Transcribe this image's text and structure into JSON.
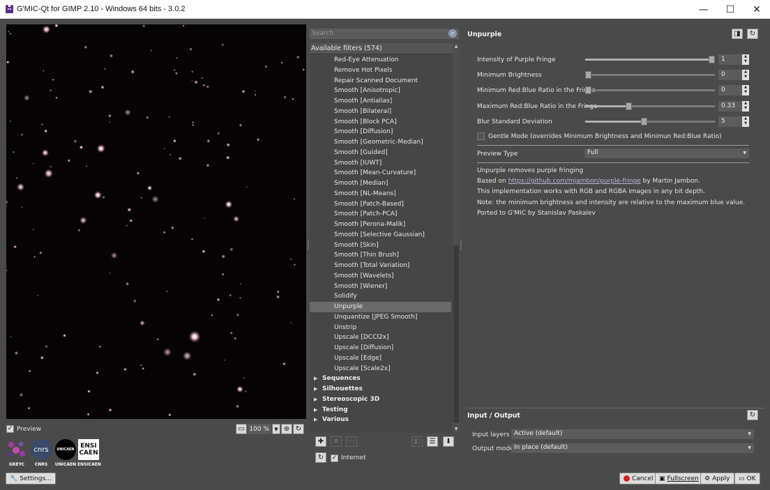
{
  "window": {
    "title": "G'MIC-Qt for GIMP 2.10 - Windows 64 bits - 3.0.2",
    "controls": {
      "minimize": "—",
      "maximize": "☐",
      "close": "✕"
    }
  },
  "preview": {
    "checkbox_label": "Preview",
    "checked": true,
    "zoom": "100 %"
  },
  "logos": [
    {
      "label": "GREYC"
    },
    {
      "label": "CNRS",
      "text": "cnrs"
    },
    {
      "label": "UNICAEN",
      "text": "UNICAEN"
    },
    {
      "label": "ENSICAEN",
      "text_top": "ENSI",
      "text_bottom": "CAEN"
    }
  ],
  "settings_button": "Settings...",
  "search": {
    "placeholder": "Search"
  },
  "filters": {
    "header": "Available filters (574)",
    "items": [
      "Red-Eye Attenuation",
      "Remove Hot Pixels",
      "Repair Scanned Document",
      "Smooth [Anisotropic]",
      "Smooth [Antialias]",
      "Smooth [Bilateral]",
      "Smooth [Block PCA]",
      "Smooth [Diffusion]",
      "Smooth [Geometric-Median]",
      "Smooth [Guided]",
      "Smooth [IUWT]",
      "Smooth [Mean-Curvature]",
      "Smooth [Median]",
      "Smooth [NL-Means]",
      "Smooth [Patch-Based]",
      "Smooth [Patch-PCA]",
      "Smooth [Perona-Malik]",
      "Smooth [Selective Gaussian]",
      "Smooth [Skin]",
      "Smooth [Thin Brush]",
      "Smooth [Total Variation]",
      "Smooth [Wavelets]",
      "Smooth [Wiener]",
      "Solidify",
      "Unpurple",
      "Unquantize [JPEG Smooth]",
      "Unstrip",
      "Upscale [DCCI2x]",
      "Upscale [Diffusion]",
      "Upscale [Edge]",
      "Upscale [Scale2x]"
    ],
    "selected_index": 24,
    "categories": [
      "Sequences",
      "Silhouettes",
      "Stereoscopic 3D",
      "Testing",
      "Various"
    ]
  },
  "internet": {
    "label": "Internet",
    "checked": true
  },
  "params": {
    "title": "Unpurple",
    "rows": [
      {
        "label": "Intensity of Purple Fringe",
        "value": "1",
        "level": 1.0
      },
      {
        "label": "Minimum Brightness",
        "value": "0",
        "level": 0.0
      },
      {
        "label": "Minimum Red:Blue Ratio in the Fringe",
        "value": "0",
        "level": 0.0
      },
      {
        "label": "Maximum Red:Blue Ratio in the Fringe",
        "value": "0.33",
        "level": 0.33
      },
      {
        "label": "Blur Standard Deviation",
        "value": "5",
        "level": 0.45
      }
    ],
    "gentle_mode": {
      "label": "Gentle Mode (overrides Minimum Brightness and Minimun Red:Blue Ratio)",
      "checked": false
    },
    "preview_type": {
      "label": "Preview Type",
      "value": "Full"
    },
    "description": {
      "line1": "Unpurple removes purple fringing",
      "line2_prefix": "Based on ",
      "line2_link": "https://github.com/mjambon/purple-fringe",
      "line2_suffix": " by Martin Jambon.",
      "line3": "This implementation works with RGB and RGBA images in any bit depth.",
      "line4": "Note: the minimum brightness and intensity are relative to the maximum blue value.",
      "line5": "Ported to G'MIC by Stanislav Paskalev"
    }
  },
  "io": {
    "title": "Input / Output",
    "input_layers_label": "Input layers",
    "input_layers_value": "Active (default)",
    "output_mode_label": "Output mode",
    "output_mode_value": "In place (default)"
  },
  "buttons": {
    "cancel": "Cancel",
    "fullscreen": "Fullscreen",
    "apply": "Apply",
    "ok": "OK"
  },
  "colors": {
    "background": "#4a4a4a",
    "preview_bg": "#050304",
    "star": "#e8b7c0"
  }
}
